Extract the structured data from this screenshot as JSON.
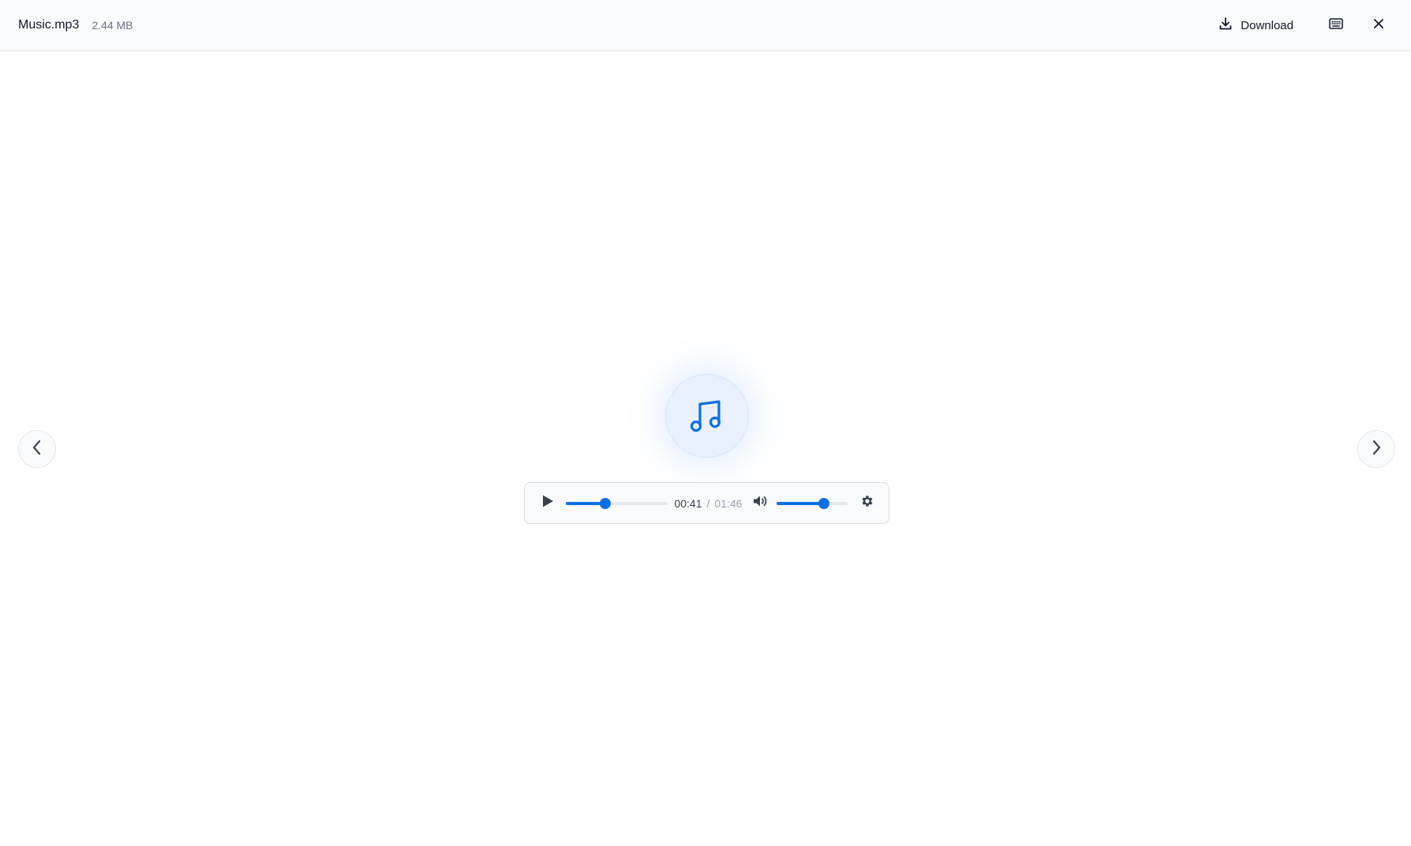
{
  "header": {
    "file_name": "Music.mp3",
    "file_size": "2.44 MB",
    "download_label": "Download",
    "icons": [
      "download-icon",
      "keyboard-icon",
      "close-icon"
    ]
  },
  "navigation": {
    "prev_icon": "chevron-left-icon",
    "next_icon": "chevron-right-icon"
  },
  "preview": {
    "icon": "music-note-icon",
    "accent_color": "#0b6fe3"
  },
  "player": {
    "current_time": "00:41",
    "separator": "/",
    "duration": "01:46",
    "seek_progress": 0.39,
    "volume_level": 0.66,
    "icons": [
      "play-icon",
      "volume-icon",
      "settings-icon"
    ]
  }
}
